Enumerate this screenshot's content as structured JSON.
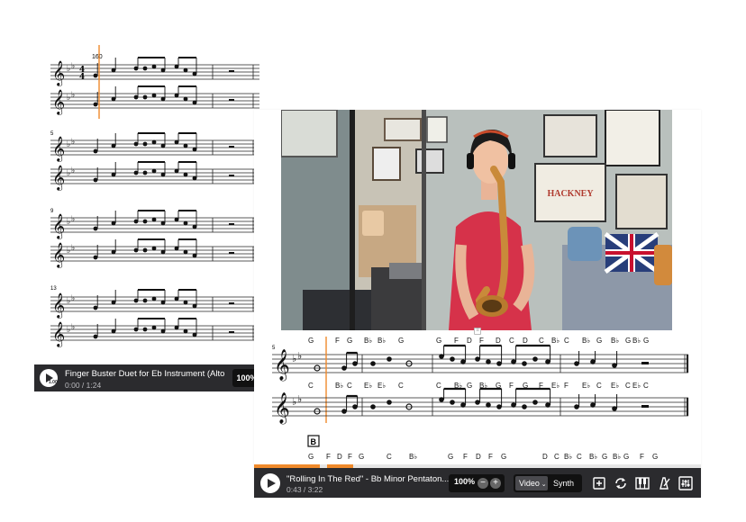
{
  "back_player": {
    "tempo": "160",
    "measure_numbers": [
      "5",
      "9",
      "13"
    ],
    "title": "Finger Buster Duet for Eb Instrument (Alto &...",
    "time": "0:00 / 1:24",
    "zoom": "100%",
    "play_badge": "1.00"
  },
  "front_player": {
    "measure_number": "5",
    "section_marker": "B",
    "chords_top": [
      "G",
      "F",
      "G",
      "B♭",
      "B♭",
      "G",
      "G",
      "F",
      "D",
      "F",
      "D",
      "C",
      "D",
      "C",
      "B♭",
      "C",
      "B♭",
      "G",
      "B♭",
      "G",
      "B♭",
      "G"
    ],
    "chords_bottom": [
      "C",
      "B♭",
      "C",
      "E♭",
      "E♭",
      "C",
      "C",
      "B♭",
      "G",
      "B♭",
      "G",
      "F",
      "G",
      "F",
      "E♭",
      "F",
      "E♭",
      "C",
      "E♭",
      "C",
      "E♭",
      "C"
    ],
    "chords_next": [
      "G",
      "F",
      "D",
      "F",
      "G",
      "C",
      "B♭",
      "G",
      "F",
      "D",
      "F",
      "G",
      "D",
      "C",
      "B♭",
      "C",
      "B♭",
      "G",
      "B♭",
      "G",
      "F",
      "G"
    ],
    "title": "\"Rolling In The Red\" - Bb Minor Pentaton...",
    "time": "0:43 / 3:22",
    "zoom": "100%",
    "zoom_minus": "−",
    "zoom_plus": "+",
    "mode_selected": "Video",
    "mode_other": "Synth",
    "video_sign": "HACKNEY",
    "progress": [
      0.148,
      0.156
    ],
    "icons": [
      "add-layer-icon",
      "loop-icon",
      "piano-icon",
      "metronome-icon",
      "mixer-icon"
    ]
  },
  "colors": {
    "accent": "#f08a2b",
    "bar": "#2b2b2e",
    "dress": "#d6324a"
  }
}
